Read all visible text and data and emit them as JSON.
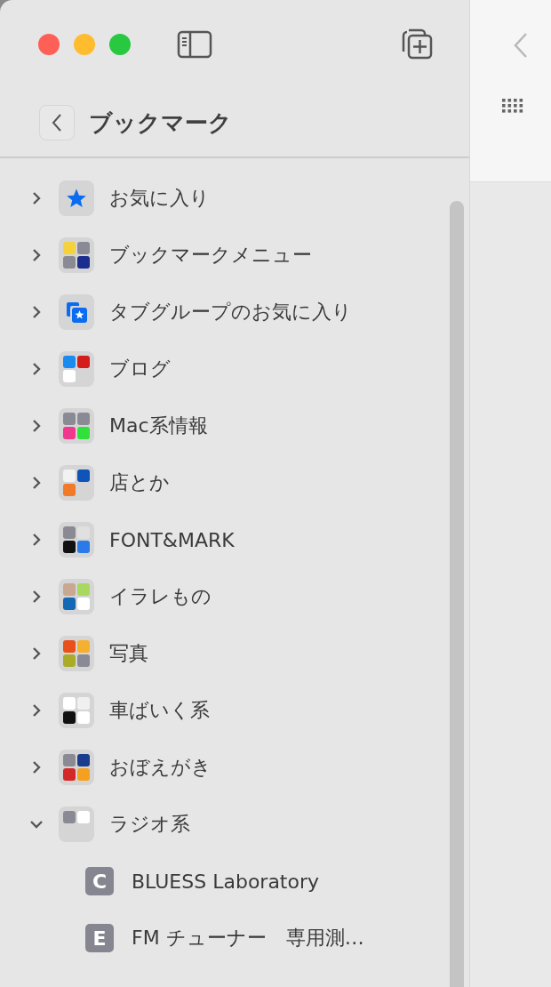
{
  "header": {
    "title": "ブックマーク"
  },
  "folders": [
    {
      "name": "お気に入り",
      "expanded": false,
      "kind": "star"
    },
    {
      "name": "ブックマークメニュー",
      "expanded": false,
      "kind": "favicons",
      "tiles": [
        {
          "color": "#f5d23c"
        },
        {
          "color": "#8a8a94"
        },
        {
          "color": "#8a8a94"
        },
        {
          "color": "#1b2d8f"
        }
      ]
    },
    {
      "name": "タブグループのお気に入り",
      "expanded": false,
      "kind": "tab-group"
    },
    {
      "name": "ブログ",
      "expanded": false,
      "kind": "favicons",
      "tiles": [
        {
          "color": "#1a8cf0"
        },
        {
          "color": "#d41c1c"
        },
        {
          "color": "#ffffff"
        }
      ]
    },
    {
      "name": "Mac系情報",
      "expanded": false,
      "kind": "favicons",
      "tiles": [
        {
          "color": "#8a8a94"
        },
        {
          "color": "#8a8a94"
        },
        {
          "color": "#f0388c"
        },
        {
          "color": "#32e03c"
        }
      ]
    },
    {
      "name": "店とか",
      "expanded": false,
      "kind": "favicons",
      "tiles": [
        {
          "color": "#f2f2f2"
        },
        {
          "color": "#0f54b8"
        },
        {
          "color": "#f07a28"
        }
      ]
    },
    {
      "name": "FONT&MARK",
      "expanded": false,
      "kind": "favicons",
      "tiles": [
        {
          "color": "#8a8a94"
        },
        {
          "color": "#e0e0e0"
        },
        {
          "color": "#111111"
        },
        {
          "color": "#2a7ae8"
        }
      ]
    },
    {
      "name": "イラレもの",
      "expanded": false,
      "kind": "favicons",
      "tiles": [
        {
          "color": "#c8a890"
        },
        {
          "color": "#a8d860"
        },
        {
          "color": "#1468b4"
        },
        {
          "color": "#ffffff"
        }
      ]
    },
    {
      "name": "写真",
      "expanded": false,
      "kind": "favicons",
      "tiles": [
        {
          "color": "#e8501c"
        },
        {
          "color": "#f5b030"
        },
        {
          "color": "#a8ac28"
        },
        {
          "color": "#8a8a94"
        }
      ]
    },
    {
      "name": "車ばいく系",
      "expanded": false,
      "kind": "favicons",
      "tiles": [
        {
          "color": "#ffffff"
        },
        {
          "color": "#f0f0f0"
        },
        {
          "color": "#111111"
        },
        {
          "color": "#ffffff"
        }
      ]
    },
    {
      "name": "おぼえがき",
      "expanded": false,
      "kind": "favicons",
      "tiles": [
        {
          "color": "#8a8a94"
        },
        {
          "color": "#1a3c8c"
        },
        {
          "color": "#d42828"
        },
        {
          "color": "#f5a020"
        }
      ]
    },
    {
      "name": "ラジオ系",
      "expanded": true,
      "kind": "favicons",
      "tiles": [
        {
          "color": "#8a8a94"
        },
        {
          "color": "#ffffff"
        }
      ],
      "children": [
        {
          "badge": "C",
          "name": "BLUESS Laboratory"
        },
        {
          "badge": "E",
          "name": "FM チューナー　専用測…"
        }
      ]
    }
  ]
}
